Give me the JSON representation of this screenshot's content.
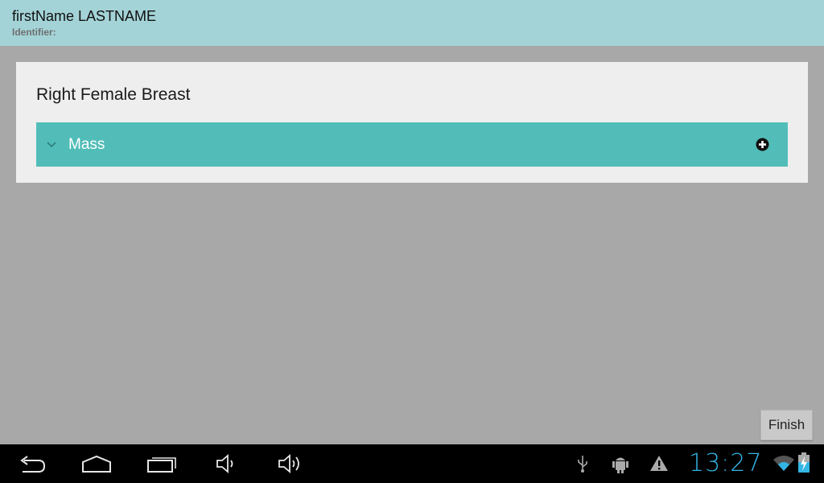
{
  "header": {
    "patient_name": "firstName LASTNAME",
    "identifier_label": "Identifier:"
  },
  "panel": {
    "title": "Right Female Breast",
    "groups": [
      {
        "label": "Mass",
        "expand_icon": "chevron-down-icon",
        "action_icon": "plus-circle-icon"
      }
    ]
  },
  "footer": {
    "finish_label": "Finish"
  },
  "system_bar": {
    "nav_icons": [
      "back-icon",
      "home-icon",
      "recent-apps-icon",
      "volume-down-icon",
      "volume-up-icon"
    ],
    "status_icons": [
      "usb-icon",
      "android-debug-icon",
      "warning-icon",
      "wifi-icon",
      "battery-charging-icon"
    ],
    "time": "13:27"
  },
  "colors": {
    "header_bg": "#a3d3d7",
    "accent": "#52bdb8",
    "clock": "#33b5e5",
    "background": "#a8a8a8"
  }
}
